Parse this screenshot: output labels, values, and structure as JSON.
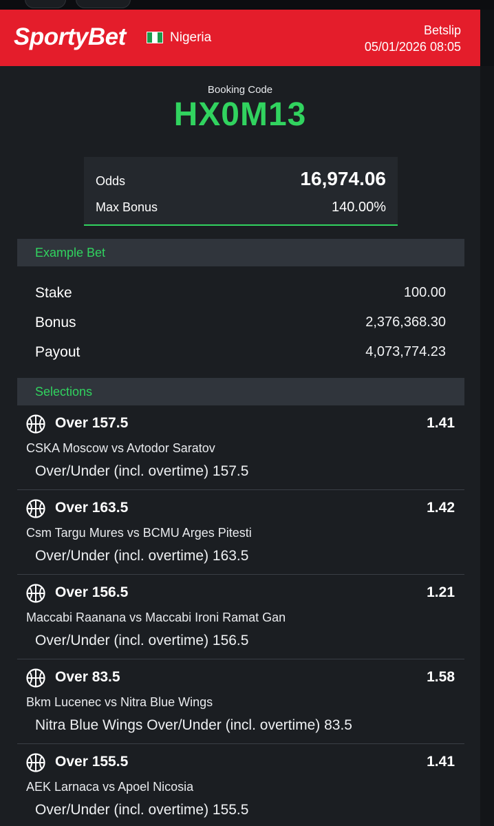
{
  "brand": {
    "name": "SportyBet",
    "country": "Nigeria",
    "color": "#e41d2b",
    "accent": "#31d35f"
  },
  "header": {
    "title": "Betslip",
    "datetime": "05/01/2026 08:05"
  },
  "booking": {
    "label": "Booking Code",
    "code": "HX0M13"
  },
  "summary": {
    "odds_label": "Odds",
    "odds_value": "16,974.06",
    "bonus_label": "Max Bonus",
    "bonus_value": "140.00%"
  },
  "example_bet": {
    "title": "Example Bet",
    "rows": [
      {
        "label": "Stake",
        "value": "100.00"
      },
      {
        "label": "Bonus",
        "value": "2,376,368.30"
      },
      {
        "label": "Payout",
        "value": "4,073,774.23"
      }
    ]
  },
  "selections": {
    "title": "Selections",
    "icon": "basketball-icon",
    "items": [
      {
        "pick": "Over 157.5",
        "odds": "1.41",
        "match": "CSKA Moscow vs Avtodor Saratov",
        "market": "Over/Under (incl. overtime) 157.5"
      },
      {
        "pick": "Over 163.5",
        "odds": "1.42",
        "match": "Csm Targu Mures vs BCMU Arges Pitesti",
        "market": "Over/Under (incl. overtime) 163.5"
      },
      {
        "pick": "Over 156.5",
        "odds": "1.21",
        "match": "Maccabi Raanana vs Maccabi Ironi Ramat Gan",
        "market": "Over/Under (incl. overtime) 156.5"
      },
      {
        "pick": "Over 83.5",
        "odds": "1.58",
        "match": "Bkm Lucenec vs Nitra Blue Wings",
        "market": "Nitra Blue Wings Over/Under (incl. overtime) 83.5"
      },
      {
        "pick": "Over 155.5",
        "odds": "1.41",
        "match": "AEK Larnaca vs Apoel Nicosia",
        "market": "Over/Under (incl. overtime) 155.5"
      }
    ]
  }
}
